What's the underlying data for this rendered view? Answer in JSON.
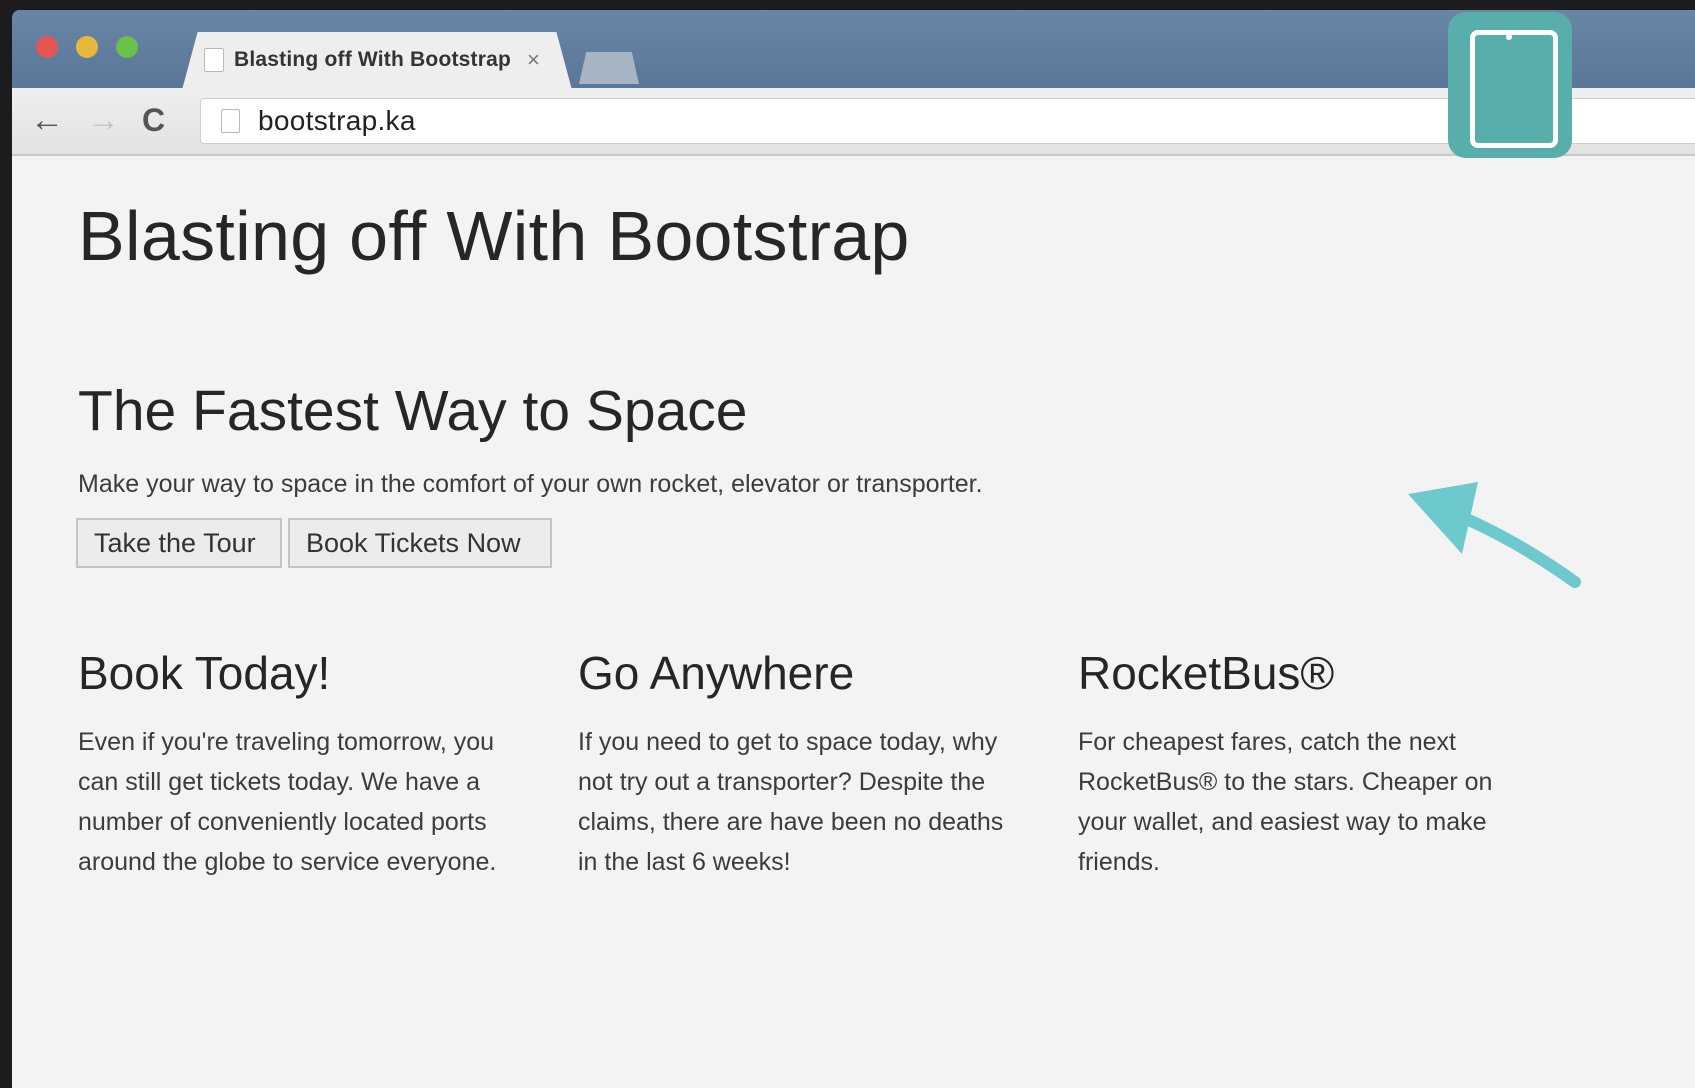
{
  "browser": {
    "tab_title": "Blasting off With Bootstrap",
    "tab_close": "×",
    "url": "bootstrap.ka",
    "back_glyph": "←",
    "forward_glyph": "→",
    "reload_glyph": "C"
  },
  "page": {
    "title": "Blasting off With Bootstrap",
    "hero": {
      "heading": "The Fastest Way to Space",
      "text": "Make your way to space in the comfort of your own rocket, elevator or transporter.",
      "buttons": [
        "Take the Tour",
        "Book Tickets Now"
      ]
    },
    "columns": [
      {
        "heading": "Book Today!",
        "text": "Even if you're traveling tomorrow, you can still get tickets today. We have a number of conveniently located ports around the globe to service everyone."
      },
      {
        "heading": "Go Anywhere",
        "text": "If you need to get to space today, why not try out a transporter? Despite the claims, there are have been no deaths in the last 6 weeks!"
      },
      {
        "heading": "RocketBus®",
        "text": "For cheapest fares, catch the next RocketBus® to the stars. Cheaper on your wallet, and easiest way to make friends."
      }
    ]
  },
  "overlay": {
    "badge_icon": "tablet-icon",
    "accent_color": "#57aeab",
    "arrow_color": "#6ec9cf"
  }
}
